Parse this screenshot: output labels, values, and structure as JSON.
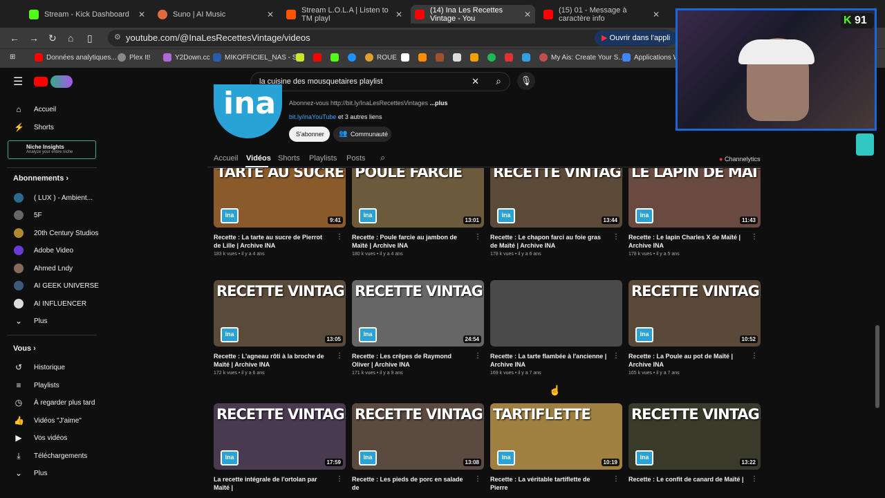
{
  "browser": {
    "tabs": [
      {
        "label": "Stream - Kick Dashboard",
        "color": "#53fc18"
      },
      {
        "label": "Suno | AI Music",
        "color": "#e06a3c"
      },
      {
        "label": "Stream L.O.L.A | Listen to TM playl",
        "color": "#ff5500"
      },
      {
        "label": "(14) Ina Les Recettes Vintage - You",
        "color": "#ff0000"
      },
      {
        "label": "(15) 01 - Message à caractère info",
        "color": "#ff0000"
      }
    ],
    "url": "youtube.com/@InaLesRecettesVintage/videos",
    "open_app": "Ouvrir dans l'appli",
    "bookmarks": [
      "Données analytiques...",
      "Plex It!",
      "Y2Down.cc",
      "MIKOFFICIEL_NAS - S...",
      "ROUE",
      "My Ais: Create Your S...",
      "Applications We"
    ]
  },
  "search": {
    "query": "la cuisine des mousquetaires playlist"
  },
  "sidebar": {
    "accueil": "Accueil",
    "shorts": "Shorts",
    "niche_title": "Niche Insights",
    "niche_sub": "Analyze your entire niche",
    "abonnements": "Abonnements",
    "subs": [
      "( LUX ) - Ambient...",
      "5F",
      "20th Century Studios",
      "Adobe Video",
      "Ahmed Lndy",
      "AI GEEK UNIVERSE",
      "AI INFLUENCER"
    ],
    "plus": "Plus",
    "vous": "Vous",
    "vous_items": [
      "Historique",
      "Playlists",
      "À regarder plus tard",
      "Vidéos \"J'aime\"",
      "Vos vidéos",
      "Téléchargements",
      "Plus"
    ]
  },
  "channel": {
    "logo_text": "ina",
    "description": "Abonnez-vous http://bit.ly/InaLesRecettesVintages",
    "more": "...plus",
    "link": "bit.ly/inaYouTube",
    "other_links": "et 3 autres liens",
    "subscribe": "S'abonner",
    "community": "Communauté",
    "tabs": [
      "Accueil",
      "Vidéos",
      "Shorts",
      "Playlists",
      "Posts"
    ],
    "channelytics": "Channelytics"
  },
  "videos": [
    {
      "banner": "TARTE AU SUCRE",
      "duration": "9:41",
      "title": "Recette : La tarte au sucre de Pierrot de Lille | Archive INA",
      "meta": "183 k vues • il y a 4 ans",
      "bg": "#8a5a2a"
    },
    {
      "banner": "POULE FARCIE",
      "duration": "13:01",
      "title": "Recette : Poule farcie au jambon de Maïté | Archive INA",
      "meta": "180 k vues • il y a 4 ans",
      "bg": "#6b5a3c"
    },
    {
      "banner": "RECETTE VINTAGE",
      "duration": "13:44",
      "title": "Recette : Le chapon farci au foie gras de Maïté | Archive INA",
      "meta": "178 k vues • il y a 6 ans",
      "bg": "#5c4a38"
    },
    {
      "banner": "LE LAPIN DE MAÏTÉ",
      "duration": "11:43",
      "title": "Recette : Le lapin Charles X de Maïté | Archive INA",
      "meta": "178 k vues • il y a 5 ans",
      "bg": "#6a4a40"
    },
    {
      "banner": "RECETTE VINTAGE",
      "duration": "13:05",
      "title": "Recette : L'agneau rôti à la broche de Maïté | Archive INA",
      "meta": "172 k vues • il y a 6 ans",
      "bg": "#5a4a3a"
    },
    {
      "banner": "RECETTE VINTAGE",
      "duration": "24:54",
      "title": "Recette : Les crêpes de Raymond Oliver | Archive INA",
      "meta": "171 k vues • il y a 9 ans",
      "bg": "#666666"
    },
    {
      "banner": "",
      "duration": "",
      "title": "Recette : La tarte flambée à l'ancienne | Archive INA",
      "meta": "169 k vues • il y a 7 ans",
      "bg": "#4a4a4a"
    },
    {
      "banner": "RECETTE VINTAGE",
      "duration": "10:52",
      "title": "Recette : La Poule au pot de Maïté | Archive INA",
      "meta": "165 k vues • il y a 7 ans",
      "bg": "#5a4838"
    },
    {
      "banner": "RECETTE VINTAGE",
      "duration": "17:59",
      "title": "La recette intégrale de l'ortolan par Maïté |",
      "meta": "",
      "bg": "#4a3a50"
    },
    {
      "banner": "RECETTE VINTAGE",
      "duration": "13:08",
      "title": "Recette : Les pieds de porc en salade de",
      "meta": "",
      "bg": "#5a4a40"
    },
    {
      "banner": "TARTIFLETTE",
      "duration": "10:19",
      "title": "Recette : La véritable tartiflette de Pierre",
      "meta": "",
      "bg": "#a08040"
    },
    {
      "banner": "RECETTE VINTAGE",
      "duration": "13:22",
      "title": "Recette : Le confit de canard de Maïté |",
      "meta": "",
      "bg": "#3a3a2a"
    }
  ],
  "overlay": {
    "badge": "91"
  }
}
